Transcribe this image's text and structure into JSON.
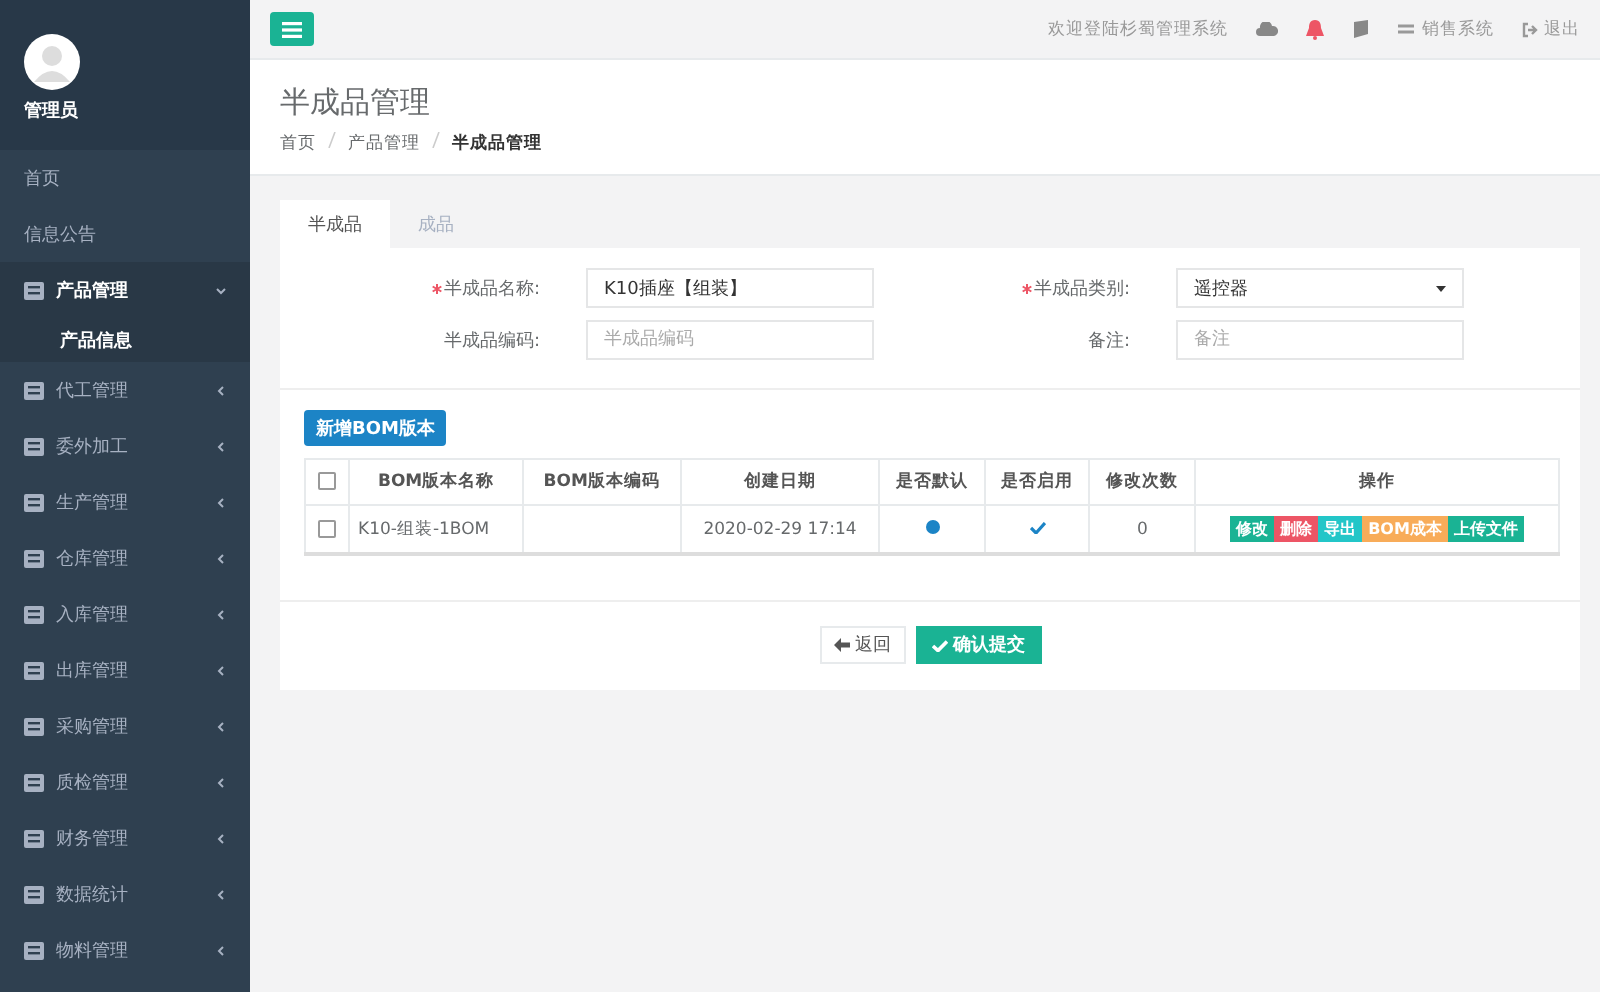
{
  "sidebar": {
    "user": "管理员",
    "items": [
      {
        "label": "首页",
        "selected": false,
        "kind": "link"
      },
      {
        "label": "信息公告",
        "selected": false,
        "kind": "link"
      },
      {
        "label": "产品管理",
        "selected": true,
        "expanded": true,
        "kind": "group",
        "children": [
          {
            "label": "产品信息",
            "selected": true
          }
        ]
      },
      {
        "label": "代工管理",
        "selected": false,
        "expanded": false,
        "kind": "group"
      },
      {
        "label": "委外加工",
        "selected": false,
        "expanded": false,
        "kind": "group"
      },
      {
        "label": "生产管理",
        "selected": false,
        "expanded": false,
        "kind": "group"
      },
      {
        "label": "仓库管理",
        "selected": false,
        "expanded": false,
        "kind": "group"
      },
      {
        "label": "入库管理",
        "selected": false,
        "expanded": false,
        "kind": "group"
      },
      {
        "label": "出库管理",
        "selected": false,
        "expanded": false,
        "kind": "group"
      },
      {
        "label": "采购管理",
        "selected": false,
        "expanded": false,
        "kind": "group"
      },
      {
        "label": "质检管理",
        "selected": false,
        "expanded": false,
        "kind": "group"
      },
      {
        "label": "财务管理",
        "selected": false,
        "expanded": false,
        "kind": "group"
      },
      {
        "label": "数据统计",
        "selected": false,
        "expanded": false,
        "kind": "group"
      },
      {
        "label": "物料管理",
        "selected": false,
        "expanded": false,
        "kind": "group"
      }
    ]
  },
  "topbar": {
    "welcome": "欢迎登陆杉蜀管理系统",
    "switch": "销售系统",
    "logout": "退出"
  },
  "header": {
    "title": "半成品管理",
    "breadcrumb": [
      "首页",
      "产品管理",
      "半成品管理"
    ]
  },
  "tabs": [
    {
      "label": "半成品",
      "selected": true
    },
    {
      "label": "成品",
      "selected": false
    }
  ],
  "form": [
    {
      "label": "半成品名称:",
      "required": true,
      "kind": "input",
      "value": "K10插座【组装】"
    },
    {
      "label": "半成品类别:",
      "required": true,
      "kind": "select",
      "value": "遥控器"
    },
    {
      "label": "半成品编码:",
      "required": false,
      "kind": "input",
      "placeholder": "半成品编码"
    },
    {
      "label": "备注:",
      "required": false,
      "kind": "input",
      "placeholder": "备注"
    }
  ],
  "add_button": "新增BOM版本",
  "table": {
    "all_checked": false,
    "columns": [
      "BOM版本名称",
      "BOM版本编码",
      "创建日期",
      "是否默认",
      "是否启用",
      "修改次数",
      "操作"
    ],
    "rows": [
      {
        "checked": false,
        "name": "K10-组装-1BOM",
        "code": "",
        "date": "2020-02-29 17:14",
        "default": true,
        "enabled": true,
        "count": "0",
        "actions": [
          {
            "label": "修改",
            "color": "#1ab394"
          },
          {
            "label": "删除",
            "color": "#ed5565"
          },
          {
            "label": "导出",
            "color": "#23c6c8"
          },
          {
            "label": "BOM成本",
            "color": "#f8ac59"
          },
          {
            "label": "上传文件",
            "color": "#1ab394"
          }
        ]
      }
    ]
  },
  "buttons": {
    "back": "返回",
    "submit": "确认提交"
  }
}
